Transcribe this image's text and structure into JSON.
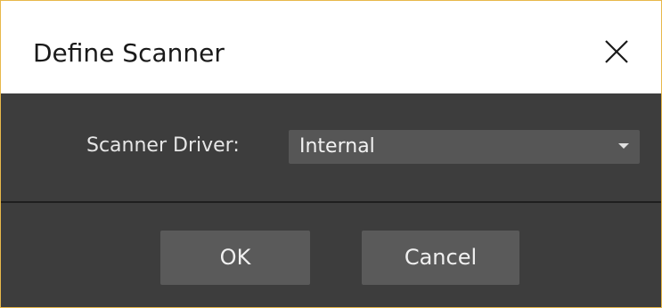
{
  "dialog": {
    "title": "Define Scanner",
    "close_icon": "close-icon"
  },
  "form": {
    "scanner_driver_label": "Scanner Driver:",
    "scanner_driver_value": "Internal",
    "dropdown_icon": "chevron-down-icon"
  },
  "buttons": {
    "ok_label": "OK",
    "cancel_label": "Cancel"
  },
  "colors": {
    "accent_border": "#e8b84a",
    "panel_background": "#3d3d3d",
    "control_background": "#565656"
  }
}
